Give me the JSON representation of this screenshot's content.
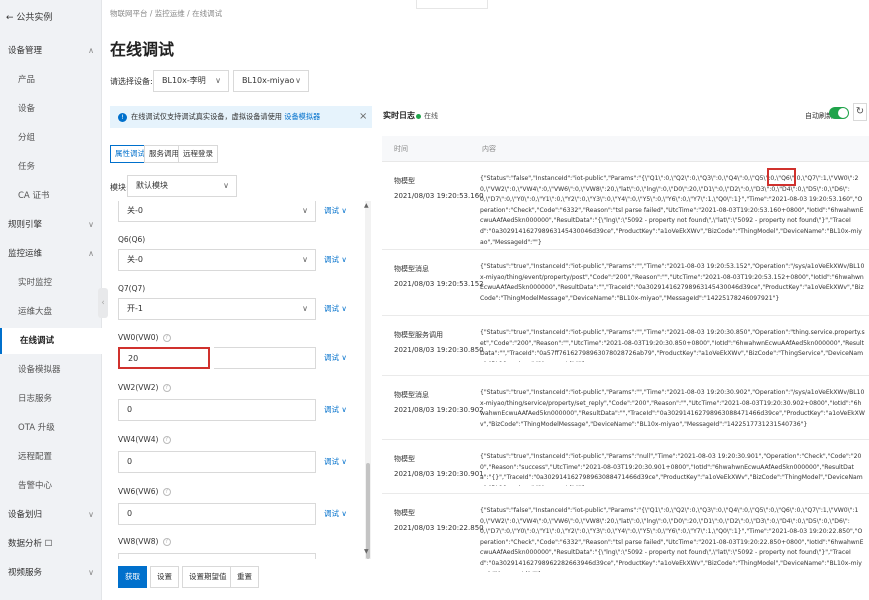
{
  "sidebar": {
    "back": "← 公共实例",
    "rows": [
      {
        "label": "设备管理",
        "kind": "group",
        "chevron": "∧"
      },
      {
        "label": "产品",
        "kind": "item"
      },
      {
        "label": "设备",
        "kind": "item"
      },
      {
        "label": "分组",
        "kind": "item"
      },
      {
        "label": "任务",
        "kind": "item"
      },
      {
        "label": "CA 证书",
        "kind": "item"
      },
      {
        "label": "规则引擎",
        "kind": "group",
        "chevron": "∨"
      },
      {
        "label": "监控运维",
        "kind": "group",
        "chevron": "∧"
      },
      {
        "label": "实时监控",
        "kind": "item"
      },
      {
        "label": "运维大盘",
        "kind": "item"
      },
      {
        "label": "在线调试",
        "kind": "item",
        "active": true
      },
      {
        "label": "设备模拟器",
        "kind": "item"
      },
      {
        "label": "日志服务",
        "kind": "item"
      },
      {
        "label": "OTA 升级",
        "kind": "item"
      },
      {
        "label": "远程配置",
        "kind": "item"
      },
      {
        "label": "告警中心",
        "kind": "item"
      },
      {
        "label": "设备划归",
        "kind": "group",
        "chevron": "∨"
      },
      {
        "label": "数据分析 ☐",
        "kind": "group"
      },
      {
        "label": "视频服务",
        "kind": "group",
        "chevron": "∨"
      }
    ]
  },
  "breadcrumb": "物联网平台  /  监控运维  /  在线调试",
  "page_title": "在线调试",
  "device_select": {
    "label": "请选择设备:",
    "product": "BL10x-李明",
    "device": "BL10x-miyao"
  },
  "info_bar": {
    "text": "在线调试仅支持调试真实设备，虚拟设备请使用",
    "link": "设备模拟器",
    "close": "×"
  },
  "tabs": [
    "属性调试",
    "服务调用",
    "远程登录"
  ],
  "module": {
    "label": "模块:",
    "value": "默认模块"
  },
  "properties": [
    {
      "label": "",
      "value": "关-0",
      "type": "select"
    },
    {
      "label": "Q6(Q6)",
      "value": "关-0",
      "type": "select"
    },
    {
      "label": "Q7(Q7)",
      "value": "开-1",
      "type": "select"
    },
    {
      "label": "VW0(VW0)",
      "value": "20",
      "type": "input",
      "highlight": true
    },
    {
      "label": "VW2(VW2)",
      "value": "0",
      "type": "input"
    },
    {
      "label": "VW4(VW4)",
      "value": "0",
      "type": "input"
    },
    {
      "label": "VW6(VW6)",
      "value": "0",
      "type": "input"
    },
    {
      "label": "VW8(VW8)",
      "value": "",
      "type": "input"
    }
  ],
  "debug_link": "调试 ∨",
  "buttons": [
    "获取",
    "设置",
    "设置期望值",
    "重置"
  ],
  "log_panel": {
    "title": "实时日志",
    "status": "在线",
    "auto_refresh": "自动刷新",
    "auto_refresh_on": true,
    "col_time": "时间",
    "col_content": "内容"
  },
  "logs": [
    {
      "type": "物模型",
      "time": "2021/08/03 19:20:53.160",
      "content": "{\"Status\":\"false\",\"InstanceId\":\"iot-public\",\"Params\":\"{\\\"Q1\\\":0,\\\"Q2\\\":0,\\\"Q3\\\":0,\\\"Q4\\\":0,\\\"Q5\\\":0,\\\"Q6\\\":0,\\\"Q7\\\":1,\\\"VW0\\\":20,\\\"VW2\\\":0,\\\"VW4\\\":0,\\\"VW6\\\":0,\\\"VW8\\\":20,\\\"lat\\\":0,\\\"lng\\\":0,\\\"D0\\\":20,\\\"D1\\\":0,\\\"D2\\\":0,\\\"D3\\\":0,\\\"D4\\\":0,\\\"D5\\\":0,\\\"D6\\\":0,\\\"D7\\\":0,\\\"Y0\\\":0,\\\"Y1\\\":0,\\\"Y2\\\":0,\\\"Y3\\\":0,\\\"Y4\\\":0,\\\"Y5\\\":0,\\\"Y6\\\":0,\\\"Y7\\\":1,\\\"Q0\\\":1}\",\"Time\":\"2021-08-03 19:20:53.160\",\"Operation\":\"Check\",\"Code\":\"6332\",\"Reason\":\"tsl parse failed\",\"UtcTime\":\"2021-08-03T19:20:53.160+0800\",\"IotId\":\"6hwahwnEcwuAAfAed5kn000000\",\"ResultData\":\"{\\\"lng\\\":\\\"5092 - property not found\\\",\\\"lat\\\":\\\"5092 - property not found\\\"}\",\"TraceId\":\"0a302914162798963145430046d39ce\",\"ProductKey\":\"a1oVeEkXWv\",\"BizCode\":\"ThingModel\",\"DeviceName\":\"BL10x-miyao\",\"MessageId\":\"\"}"
    },
    {
      "type": "物模型消息",
      "time": "2021/08/03 19:20:53.152",
      "content": "{\"Status\":\"true\",\"InstanceId\":\"iot-public\",\"Params\":\"\",\"Time\":\"2021-08-03 19:20:53.152\",\"Operation\":\"/sys/a1oVeEkXWv/BL10x-miyao/thing/event/property/post\",\"Code\":\"200\",\"Reason\":\"\",\"UtcTime\":\"2021-08-03T19:20:53.152+0800\",\"IotId\":\"6hwahwnEcwuAAfAed5kn000000\",\"ResultData\":\"\",\"TraceId\":\"0a302914162798963145430046d39ce\",\"ProductKey\":\"a1oVeEkXWv\",\"BizCode\":\"ThingModelMessage\",\"DeviceName\":\"BL10x-miyao\",\"MessageId\":\"14225178246097921\"}"
    },
    {
      "type": "物模型服务调用",
      "time": "2021/08/03 19:20:30.850",
      "content": "{\"Status\":\"true\",\"InstanceId\":\"iot-public\",\"Params\":\"\",\"Time\":\"2021-08-03 19:20:30.850\",\"Operation\":\"thing.service.property.set\",\"Code\":\"200\",\"Reason\":\"\",\"UtcTime\":\"2021-08-03T19:20:30.850+0800\",\"IotId\":\"6hwahwnEcwuAAfAed5kn000000\",\"ResultData\":\"\",\"TraceId\":\"0a57ff76162798963078028726ab79\",\"ProductKey\":\"a1oVeEkXWv\",\"BizCode\":\"ThingService\",\"DeviceName\":\"BL10x-miyao\",\"MessageId\":\"\"}"
    },
    {
      "type": "物模型消息",
      "time": "2021/08/03 19:20:30.902",
      "content": "{\"Status\":\"true\",\"InstanceId\":\"iot-public\",\"Params\":\"\",\"Time\":\"2021-08-03 19:20:30.902\",\"Operation\":\"/sys/a1oVeEkXWv/BL10x-miyao/thing/service/property/set_reply\",\"Code\":\"200\",\"Reason\":\"\",\"UtcTime\":\"2021-08-03T19:20:30.902+0800\",\"IotId\":\"6hwahwnEcwuAAfAed5kn000000\",\"ResultData\":\"\",\"TraceId\":\"0a302914162798963088471466d39ce\",\"ProductKey\":\"a1oVeEkXWv\",\"BizCode\":\"ThingModelMessage\",\"DeviceName\":\"BL10x-miyao\",\"MessageId\":\"1422517731231540736\"}"
    },
    {
      "type": "物模型",
      "time": "2021/08/03 19:20:30.901",
      "content": "{\"Status\":\"true\",\"InstanceId\":\"iot-public\",\"Params\":\"null\",\"Time\":\"2021-08-03 19:20:30.901\",\"Operation\":\"Check\",\"Code\":\"200\",\"Reason\":\"success\",\"UtcTime\":\"2021-08-03T19:20:30.901+0800\",\"IotId\":\"6hwahwnEcwuAAfAed5kn000000\",\"ResultData\":\"{}\",\"TraceId\":\"0a302914162798963088471466d39ce\",\"ProductKey\":\"a1oVeEkXWv\",\"BizCode\":\"ThingModel\",\"DeviceName\":\"BL10x-miyao\",\"MessageId\":\"\"}"
    },
    {
      "type": "物模型",
      "time": "2021/08/03 19:20:22.850",
      "content": "{\"Status\":\"false\",\"InstanceId\":\"iot-public\",\"Params\":\"{\\\"Q1\\\":0,\\\"Q2\\\":0,\\\"Q3\\\":0,\\\"Q4\\\":0,\\\"Q5\\\":0,\\\"Q6\\\":0,\\\"Q7\\\":1,\\\"VW0\\\":10,\\\"VW2\\\":0,\\\"VW4\\\":0,\\\"VW6\\\":0,\\\"VW8\\\":20,\\\"lat\\\":0,\\\"lng\\\":0,\\\"D0\\\":20,\\\"D1\\\":0,\\\"D2\\\":0,\\\"D3\\\":0,\\\"D4\\\":0,\\\"D5\\\":0,\\\"D6\\\":0,\\\"D7\\\":0,\\\"Y0\\\":0,\\\"Y1\\\":0,\\\"Y2\\\":0,\\\"Y3\\\":0,\\\"Y4\\\":0,\\\"Y5\\\":0,\\\"Y6\\\":0,\\\"Y7\\\":1,\\\"Q0\\\":1}\",\"Time\":\"2021-08-03 19:20:22.850\",\"Operation\":\"Check\",\"Code\":\"6332\",\"Reason\":\"tsl parse failed\",\"UtcTime\":\"2021-08-03T19:20:22.850+0800\",\"IotId\":\"6hwahwnEcwuAAfAed5kn000000\",\"ResultData\":\"{\\\"lng\\\":\\\"5092 - property not found\\\",\\\"lat\\\":\\\"5092 - property not found\\\"}\",\"TraceId\":\"0a302914162798962282663946d39ce\",\"ProductKey\":\"a1oVeEkXWv\",\"BizCode\":\"ThingModel\",\"DeviceName\":\"BL10x-miyao\",\"MessageId\":\"\"}"
    }
  ]
}
